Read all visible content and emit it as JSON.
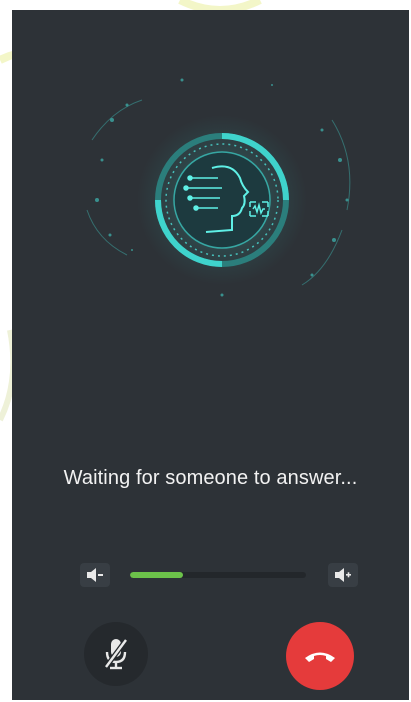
{
  "call": {
    "status_text": "Waiting for someone to answer...",
    "volume_level": 0.3,
    "volume_down_icon": "volume-down-icon",
    "volume_up_icon": "volume-up-icon",
    "mute_icon": "mic-off-icon",
    "hangup_icon": "phone-hangup-icon"
  },
  "colors": {
    "panel_bg": "#2d3237",
    "accent_teal": "#33c6c0",
    "volume_fill": "#6cc24a",
    "hangup_red": "#e53b3b"
  }
}
